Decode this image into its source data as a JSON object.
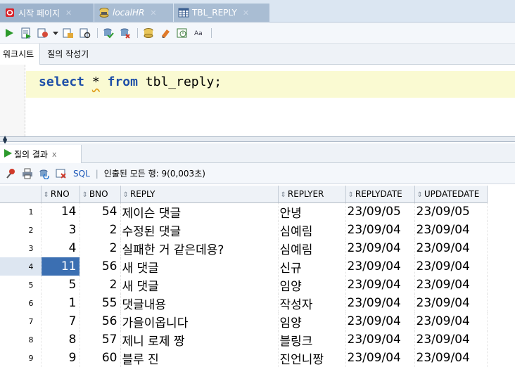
{
  "tabs": [
    {
      "label": "시작 페이지",
      "icon": "oracle-icon"
    },
    {
      "label": "localHR",
      "icon": "database-connection-icon"
    },
    {
      "label": "TBL_REPLY",
      "icon": "table-icon"
    }
  ],
  "subtabs": {
    "worksheet": "워크시트",
    "query_builder": "질의 작성기"
  },
  "editor": {
    "keyword_select": "select",
    "star": "*",
    "keyword_from": "from",
    "table": "tbl_reply;"
  },
  "result_tab": {
    "label": "질의 결과"
  },
  "result_toolbar": {
    "sql_label": "SQL",
    "status": "인출된 모든 행: 9(0,003초)"
  },
  "grid": {
    "columns": [
      "RNO",
      "BNO",
      "REPLY",
      "REPLYER",
      "REPLYDATE",
      "UPDATEDATE"
    ],
    "rows": [
      {
        "n": "1",
        "rno": "14",
        "bno": "54",
        "reply": "제이슨 댓글",
        "replyer": "안녕",
        "replydate": "23/09/05",
        "updatedate": "23/09/05"
      },
      {
        "n": "2",
        "rno": "3",
        "bno": "2",
        "reply": "수정된 댓글",
        "replyer": "심예림",
        "replydate": "23/09/04",
        "updatedate": "23/09/04"
      },
      {
        "n": "3",
        "rno": "4",
        "bno": "2",
        "reply": "실패한 거 같은데용?",
        "replyer": "심예림",
        "replydate": "23/09/04",
        "updatedate": "23/09/04"
      },
      {
        "n": "4",
        "rno": "11",
        "bno": "56",
        "reply": "새 댓글",
        "replyer": "신규",
        "replydate": "23/09/04",
        "updatedate": "23/09/04"
      },
      {
        "n": "5",
        "rno": "5",
        "bno": "2",
        "reply": "새 댓글",
        "replyer": "임양",
        "replydate": "23/09/04",
        "updatedate": "23/09/04"
      },
      {
        "n": "6",
        "rno": "1",
        "bno": "55",
        "reply": "댓글내용",
        "replyer": "작성자",
        "replydate": "23/09/04",
        "updatedate": "23/09/04"
      },
      {
        "n": "7",
        "rno": "7",
        "bno": "56",
        "reply": "가을이옵니다",
        "replyer": "임양",
        "replydate": "23/09/04",
        "updatedate": "23/09/04"
      },
      {
        "n": "8",
        "rno": "8",
        "bno": "57",
        "reply": "제니 로제 짱",
        "replyer": "블링크",
        "replydate": "23/09/04",
        "updatedate": "23/09/04"
      },
      {
        "n": "9",
        "rno": "9",
        "bno": "60",
        "reply": "블루 진",
        "replyer": "진언니짱",
        "replydate": "23/09/04",
        "updatedate": "23/09/04"
      }
    ]
  },
  "colors": {
    "tab_bar": "#dbe6f2",
    "selection": "#3b6fb2",
    "keyword": "#1e4fa8",
    "current_line": "#fafad2"
  }
}
